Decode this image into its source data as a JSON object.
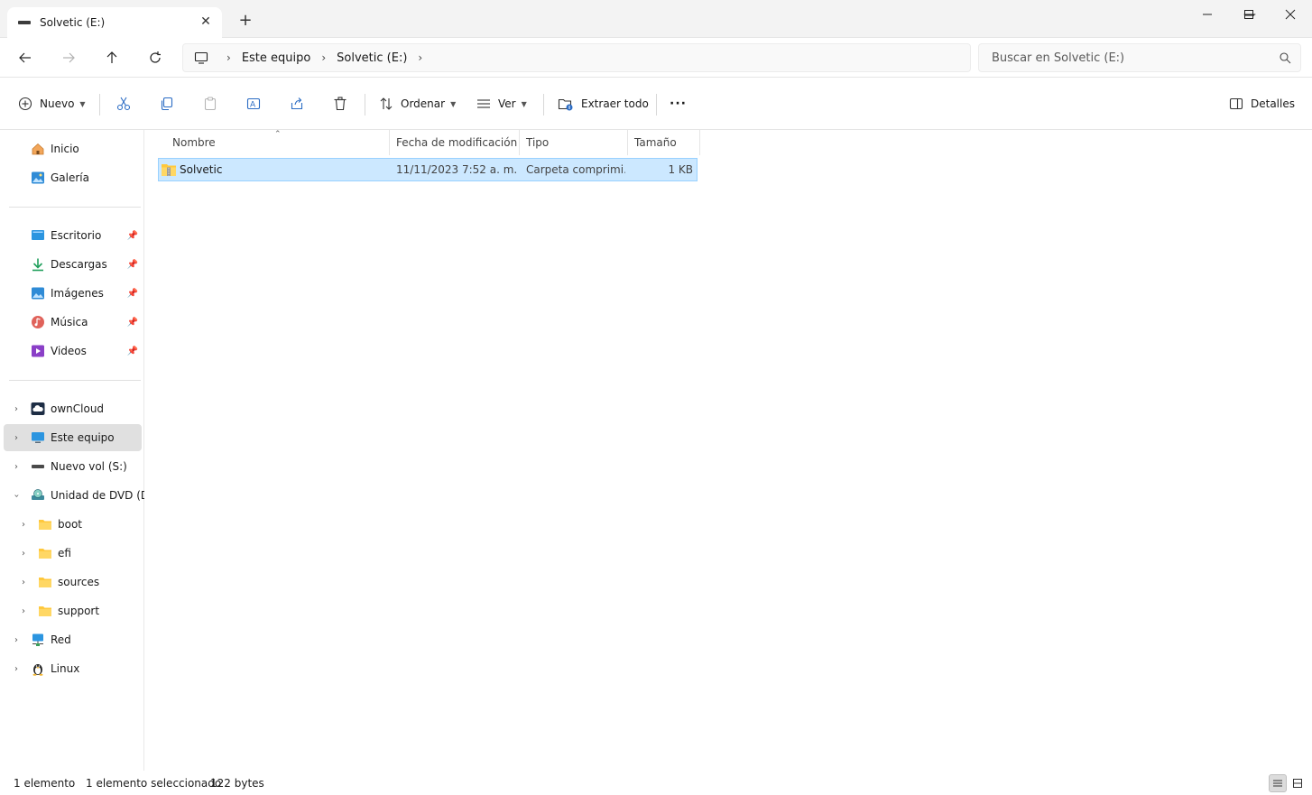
{
  "tab": {
    "title": "Solvetic (E:)",
    "close": "✕",
    "new": "+"
  },
  "window": {
    "minimize": "—",
    "maximize": "☐",
    "close": "✕"
  },
  "nav": {
    "breadcrumbs": [
      "Este equipo",
      "Solvetic (E:)"
    ],
    "search_placeholder": "Buscar en Solvetic (E:)"
  },
  "toolbar": {
    "new_label": "Nuevo",
    "sort_label": "Ordenar",
    "view_label": "Ver",
    "extract_label": "Extraer todo",
    "more_label": "···",
    "details_label": "Detalles"
  },
  "sidebar": {
    "home": "Inicio",
    "gallery": "Galería",
    "quick_access": [
      "Escritorio",
      "Descargas",
      "Imágenes",
      "Música",
      "Videos"
    ],
    "owncloud": "ownCloud",
    "this_pc": "Este equipo",
    "new_vol": "Nuevo vol (S:)",
    "dvd": "Unidad de DVD (D:)",
    "dvd_folders": [
      "boot",
      "efi",
      "sources",
      "support"
    ],
    "network": "Red",
    "linux": "Linux"
  },
  "columns": {
    "name": "Nombre",
    "modified": "Fecha de modificación",
    "type": "Tipo",
    "size": "Tamaño"
  },
  "files": [
    {
      "name": "Solvetic",
      "modified": "11/11/2023 7:52 a. m.",
      "type": "Carpeta comprimi...",
      "size": "1 KB"
    }
  ],
  "status": {
    "count": "1 elemento",
    "selected": "1 elemento seleccionado",
    "bytes": "122 bytes"
  },
  "colors": {
    "accent": "#0067c0",
    "selection_bg": "#cce8ff",
    "selection_border": "#99d1ff",
    "folder_yellow": "#ffc83d"
  }
}
